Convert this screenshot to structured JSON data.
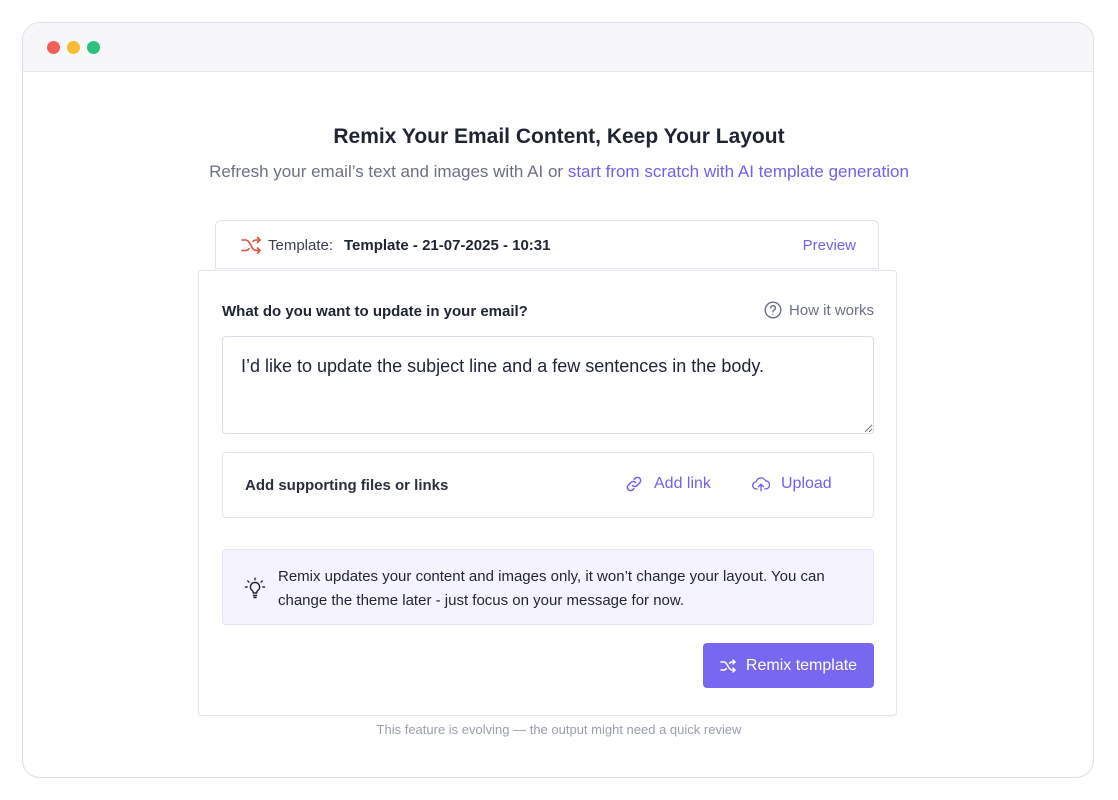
{
  "window": {
    "controls": [
      "close",
      "minimize",
      "maximize"
    ]
  },
  "header": {
    "title": "Remix Your Email Content, Keep Your Layout",
    "subtitle_prefix": "Refresh your email’s text and images with AI or ",
    "subtitle_link": "start from scratch with AI template generation"
  },
  "template_bar": {
    "icon": "shuffle-icon",
    "label": "Template:",
    "name": "Template - 21-07-2025 - 10:31",
    "preview_label": "Preview"
  },
  "form": {
    "question": "What do you want to update in your email?",
    "how_it_works_icon": "question-circle-icon",
    "how_it_works_label": "How it works",
    "request_value": "I’d like to update the subject line and a few sentences in the body.",
    "supporting_label": "Add supporting files or links",
    "add_link_icon": "link-icon",
    "add_link_label": "Add link",
    "upload_icon": "cloud-upload-icon",
    "upload_label": "Upload"
  },
  "tip": {
    "icon": "lightbulb-icon",
    "text": "Remix updates your content and images only, it won’t change your layout. You can change the theme later - just focus on your message for now."
  },
  "actions": {
    "remix_icon": "shuffle-icon",
    "remix_label": "Remix template"
  },
  "footer": {
    "note": "This feature is evolving — the output might need a quick review"
  },
  "colors": {
    "accent": "#7161ea",
    "button": "#7867f0",
    "tip_bg": "#f4f3fe",
    "shuffle_icon": "#e0523f"
  }
}
